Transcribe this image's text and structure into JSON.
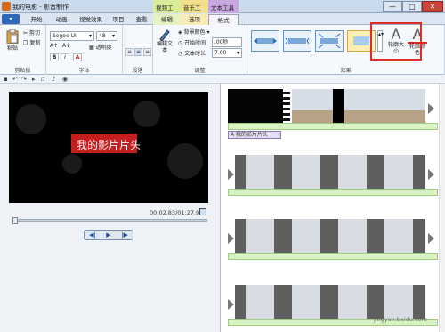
{
  "window": {
    "title": "我的电影 - 影音制作",
    "context_tabs": [
      "视频工具",
      "音乐工具",
      "文本工具"
    ],
    "min": "—",
    "max": "□",
    "close": "✕"
  },
  "tabs": {
    "file": "▾",
    "items": [
      "开始",
      "动画",
      "视觉效果",
      "项目",
      "查看",
      "编辑",
      "选项",
      "格式"
    ],
    "active_index": 7
  },
  "ribbon": {
    "clipboard": {
      "paste": "粘贴",
      "cut": "剪切",
      "copy": "复制",
      "label": "剪贴板"
    },
    "font": {
      "family": "Segoe UI",
      "size": "48",
      "transparency": "透明度",
      "bold": "B",
      "italic": "I",
      "label": "字体"
    },
    "paragraph": {
      "label": "段落"
    },
    "adjust": {
      "edit_text": "编辑文本",
      "background_color": "背景颜色",
      "start_time_label": "开始时间",
      "start_time_value": ".00秒",
      "text_duration_label": "文本时长",
      "text_duration_value": "7.00",
      "label": "调整"
    },
    "effects": {
      "label": "效果",
      "outline_size": "轮廓大小",
      "outline_color": "轮廓颜色"
    }
  },
  "preview": {
    "caption": "我的影片片头",
    "timecode": "00:02.83/01:27.94",
    "controls": [
      "◀|",
      "▶",
      "|▶"
    ]
  },
  "timeline": {
    "caption_label": "我的影片片头"
  },
  "watermark": "jingyan.baidu.com",
  "colors": {
    "accent": "#2f66b5",
    "caption_bg": "#c41e1e",
    "highlight_box": "#e12a2a"
  }
}
